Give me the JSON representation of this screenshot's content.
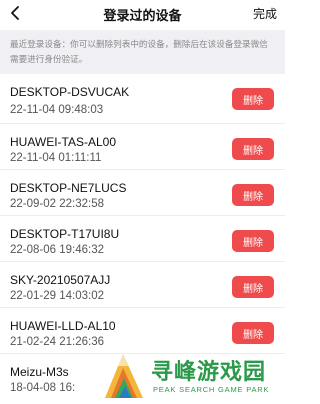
{
  "header": {
    "title": "登录过的设备",
    "done_label": "完成",
    "back_icon": "chevron-left-icon"
  },
  "notice": "最近登录设备：你可以删除列表中的设备，删除后在该设备登录微信需要进行身份验证。",
  "devices": [
    {
      "name": "DESKTOP-DSVUCAK",
      "time": "22-11-04 09:48:03",
      "delete_label": "删除"
    },
    {
      "name": "HUAWEI-TAS-AL00",
      "time": "22-11-04 01:11:11",
      "delete_label": "删除"
    },
    {
      "name": "DESKTOP-NE7LUCS",
      "time": "22-09-02 22:32:58",
      "delete_label": "删除"
    },
    {
      "name": "DESKTOP-T17UI8U",
      "time": "22-08-06 19:46:32",
      "delete_label": "删除"
    },
    {
      "name": "SKY-20210507AJJ",
      "time": "22-01-29 14:03:02",
      "delete_label": "删除"
    },
    {
      "name": "HUAWEI-LLD-AL10",
      "time": "21-02-24 21:26:36",
      "delete_label": "删除"
    },
    {
      "name": "Meizu-M3s",
      "time": "18-04-08 16:",
      "delete_label": ""
    }
  ],
  "watermark": {
    "cn": "寻峰游戏园",
    "en": "PEAK SEARCH GAME PARK"
  },
  "colors": {
    "delete_button": "#f04b4c",
    "notice_bg": "#efeff4",
    "watermark": "#2a9a4a"
  }
}
